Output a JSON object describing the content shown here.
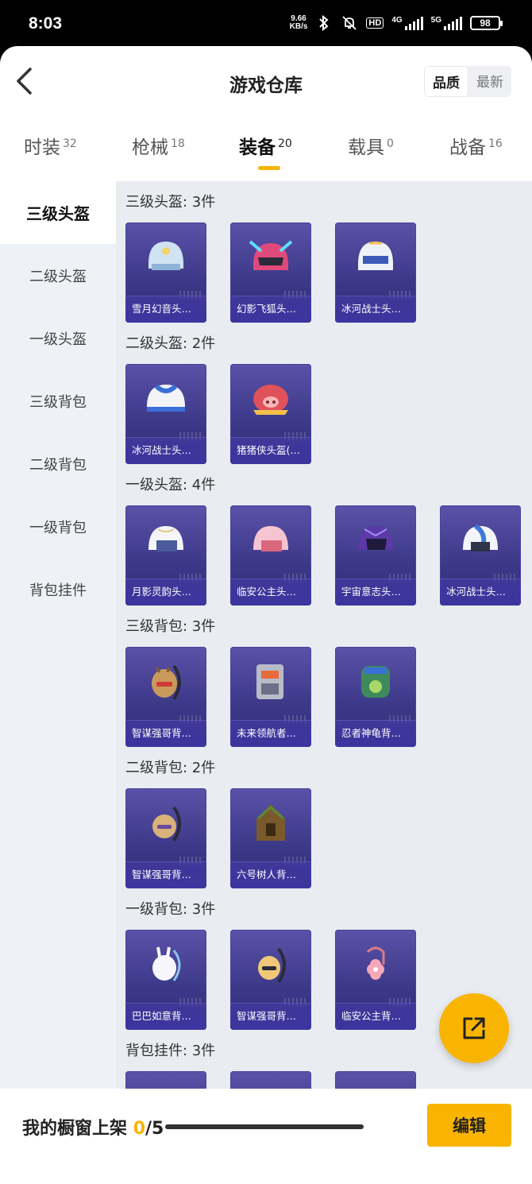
{
  "status_bar": {
    "time": "8:03",
    "net_speed_value": "9.66",
    "net_speed_unit": "KB/s",
    "hd_label": "HD",
    "sig1_label": "4G",
    "sig2_label": "5G",
    "battery": "98"
  },
  "header": {
    "title": "游戏仓库",
    "sort_options": [
      "品质",
      "最新"
    ],
    "sort_selected": "品质"
  },
  "tabs": [
    {
      "label": "时装",
      "count": "32"
    },
    {
      "label": "枪械",
      "count": "18"
    },
    {
      "label": "装备",
      "count": "20"
    },
    {
      "label": "载具",
      "count": "0"
    },
    {
      "label": "战备",
      "count": "16"
    }
  ],
  "active_tab": "装备",
  "sidebar": {
    "items": [
      "三级头盔",
      "二级头盔",
      "一级头盔",
      "三级背包",
      "二级背包",
      "一级背包",
      "背包挂件"
    ],
    "selected": "三级头盔"
  },
  "sections": [
    {
      "title": "三级头盔: 3件",
      "items": [
        "雪月幻音头…",
        "幻影飞狐头…",
        "冰河战士头…"
      ]
    },
    {
      "title": "二级头盔: 2件",
      "items": [
        "冰河战士头…",
        "猪猪侠头盔(…"
      ]
    },
    {
      "title": "一级头盔: 4件",
      "items": [
        "月影灵韵头…",
        "临安公主头…",
        "宇宙意志头…",
        "冰河战士头…"
      ]
    },
    {
      "title": "三级背包: 3件",
      "items": [
        "智谋强哥背…",
        "未来领航者…",
        "忍者神龟背…"
      ]
    },
    {
      "title": "二级背包: 2件",
      "items": [
        "智谋强哥背…",
        "六号树人背…"
      ]
    },
    {
      "title": "一级背包: 3件",
      "items": [
        "巴巴如意背…",
        "智谋强哥背…",
        "临安公主背…"
      ]
    },
    {
      "title": "背包挂件: 3件",
      "items": [
        "",
        "",
        ""
      ]
    }
  ],
  "bottom_bar": {
    "label": "我的橱窗上架",
    "current": "0",
    "total": "/5",
    "edit_label": "编辑"
  },
  "colors": {
    "accent": "#f8b400",
    "card_bg": "#3e3a8a",
    "sidebar_bg": "#eef1f5"
  }
}
